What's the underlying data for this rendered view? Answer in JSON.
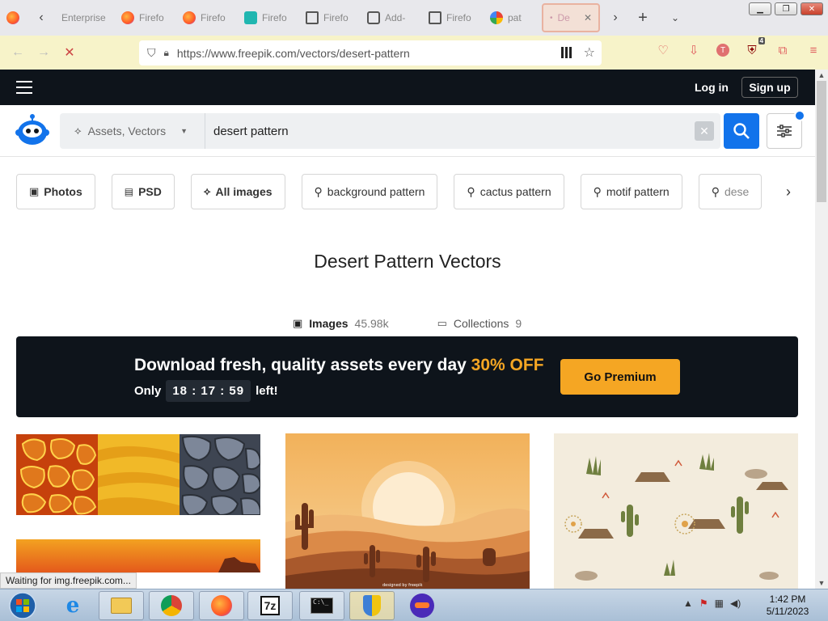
{
  "browser": {
    "tabs": [
      {
        "label": "",
        "icon": "firefox-icon"
      },
      {
        "label": "Enterprise",
        "icon": "none"
      },
      {
        "label": "Firefo",
        "icon": "firefox-icon"
      },
      {
        "label": "Firefo",
        "icon": "firefox-icon"
      },
      {
        "label": "Firefo",
        "icon": "shield-icon"
      },
      {
        "label": "Firefo",
        "icon": "search-page-icon"
      },
      {
        "label": "Add-",
        "icon": "puzzle-icon"
      },
      {
        "label": "Firefo",
        "icon": "search-page-icon"
      },
      {
        "label": "pat",
        "icon": "google-icon"
      },
      {
        "label": "De",
        "icon": "loading-icon"
      }
    ],
    "url": "https://www.freepik.com/vectors/desert-pattern",
    "extension_badge": "4",
    "avatar_letter": "T",
    "status_text": "Waiting for img.freepik.com..."
  },
  "site": {
    "login_label": "Log in",
    "signup_label": "Sign up",
    "search_type": "Assets, Vectors",
    "search_query": "desert pattern",
    "chips": [
      {
        "label": "Photos",
        "icon": "image-icon",
        "bold": true
      },
      {
        "label": "PSD",
        "icon": "psd-icon",
        "bold": true
      },
      {
        "label": "All images",
        "icon": "shapes-icon",
        "bold": true
      },
      {
        "label": "background pattern",
        "icon": "search-icon",
        "bold": false
      },
      {
        "label": "cactus pattern",
        "icon": "search-icon",
        "bold": false
      },
      {
        "label": "motif pattern",
        "icon": "search-icon",
        "bold": false
      },
      {
        "label": "dese",
        "icon": "search-icon",
        "bold": false
      }
    ],
    "page_title": "Desert Pattern Vectors",
    "counts": {
      "images_label": "Images",
      "images_value": "45.98k",
      "collections_label": "Collections",
      "collections_value": "9"
    },
    "promo": {
      "headline": "Download fresh, quality assets every day",
      "discount": "30% OFF",
      "only": "Only",
      "timer": "18 : 17 : 59",
      "left": "left!",
      "button": "Go Premium"
    }
  },
  "taskbar": {
    "time": "1:42 PM",
    "date": "5/11/2023"
  },
  "colors": {
    "accent": "#1273eb",
    "premium": "#f5a623",
    "dark": "#0e141b"
  }
}
